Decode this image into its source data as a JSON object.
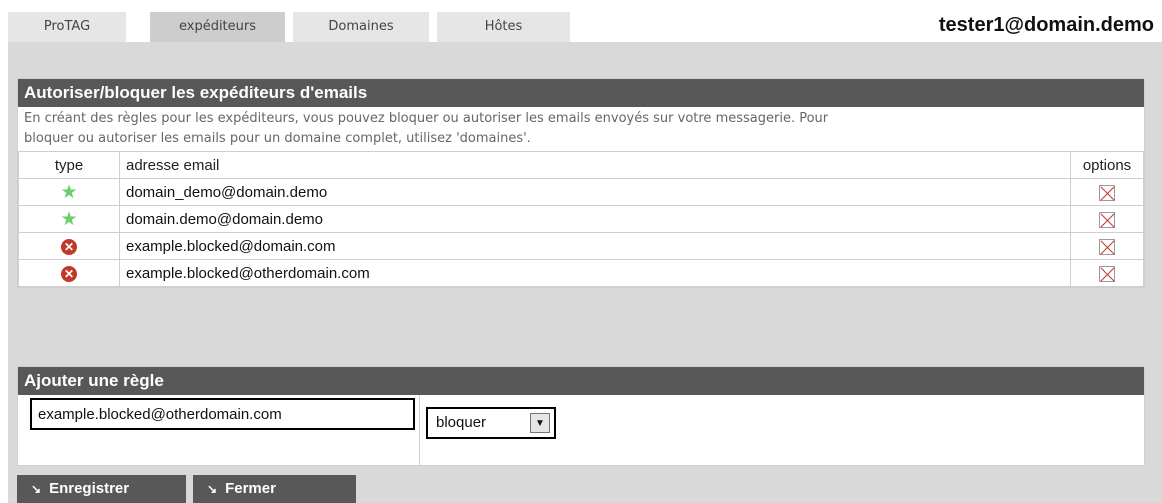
{
  "tabs": [
    {
      "label": "ProTAG",
      "active": false
    },
    {
      "label": "expéditeurs",
      "active": true
    },
    {
      "label": "Domaines",
      "active": false
    },
    {
      "label": "Hôtes",
      "active": false
    }
  ],
  "user": "tester1@domain.demo",
  "rules_panel": {
    "title": "Autoriser/bloquer les expéditeurs d'emails",
    "description_line1": "En créant des règles pour les expéditeurs, vous pouvez bloquer ou autoriser les emails envoyés sur votre messagerie. Pour",
    "description_line2": "bloquer ou autoriser les emails pour un domaine complet, utilisez 'domaines'.",
    "columns": {
      "type": "type",
      "email": "adresse email",
      "options": "options"
    },
    "rows": [
      {
        "type": "allowed",
        "icon": "star-icon",
        "email": "domain_demo@domain.demo"
      },
      {
        "type": "allowed",
        "icon": "star-icon",
        "email": "domain.demo@domain.demo"
      },
      {
        "type": "blocked",
        "icon": "blocked-icon",
        "email": "example.blocked@domain.com"
      },
      {
        "type": "blocked",
        "icon": "blocked-icon",
        "email": "example.blocked@otherdomain.com"
      }
    ]
  },
  "add_panel": {
    "title": "Ajouter une règle",
    "email_value": "example.blocked@otherdomain.com",
    "action_selected": "bloquer"
  },
  "buttons": {
    "save": "Enregistrer",
    "close": "Fermer"
  },
  "colors": {
    "header_bg": "#585858",
    "allow_star": "#6ccf6c",
    "block_red": "#c0392b"
  }
}
